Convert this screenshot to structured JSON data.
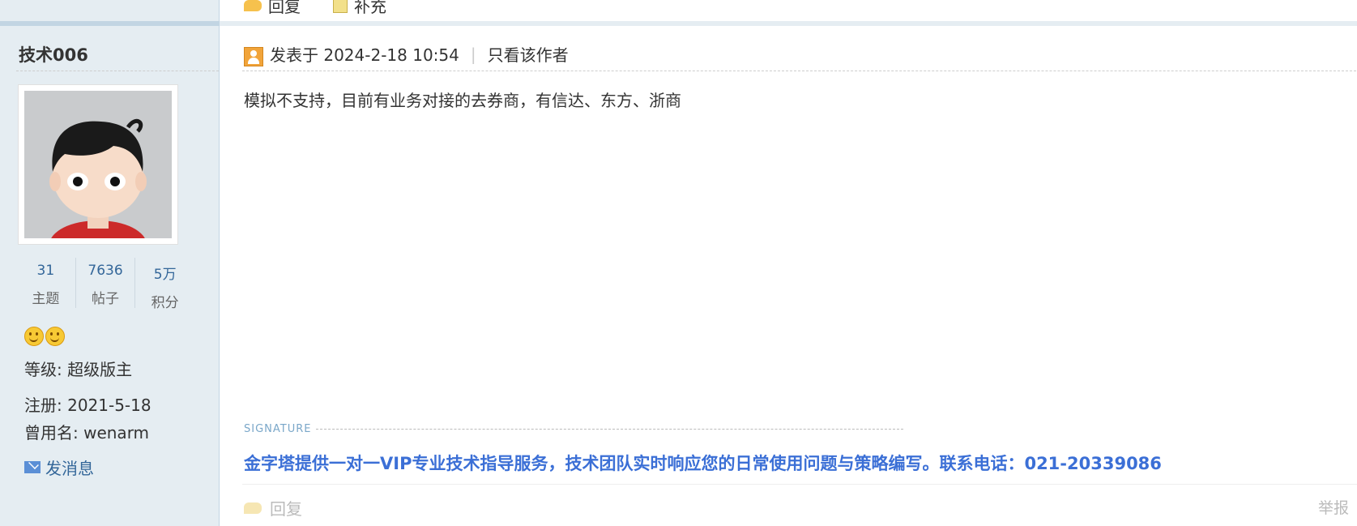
{
  "top_row": {
    "reply_label": "回复",
    "supplement_label": "补充"
  },
  "author": {
    "name": "技术006",
    "stats": [
      {
        "num": "31",
        "label": "主题"
      },
      {
        "num": "7636",
        "label": "帖子"
      },
      {
        "num": "5万",
        "label": "积分"
      }
    ],
    "level": "等级: 超级版主",
    "registered": "注册: 2021-5-18",
    "alias": "曾用名: wenarm",
    "send_message": "发消息"
  },
  "post": {
    "posted_at": "发表于 2024-2-18 10:54",
    "author_only": "只看该作者",
    "body": "模拟不支持，目前有业务对接的去券商，有信达、东方、浙商",
    "signature_label": "SIGNATURE",
    "signature": "金字塔提供一对一VIP专业技术指导服务，技术团队实时响应您的日常使用问题与策略编写。联系电话：021-20339086",
    "reply_label": "回复",
    "report_label": "举报"
  },
  "colors": {
    "sidebar_bg": "#e5edf2",
    "link": "#336699",
    "signature": "#3b6fd6"
  }
}
